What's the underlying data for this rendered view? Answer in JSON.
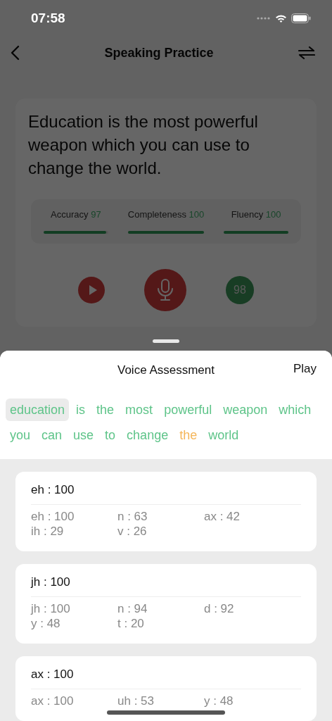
{
  "status_bar": {
    "time": "07:58"
  },
  "nav": {
    "title": "Speaking Practice"
  },
  "practice": {
    "sentence": "Education is the most powerful weapon which you can use to change the world.",
    "metrics": [
      {
        "label": "Accuracy",
        "value": "97",
        "level": 0.97
      },
      {
        "label": "Completeness",
        "value": "100",
        "level": 1
      },
      {
        "label": "Fluency",
        "value": "100",
        "level": 1
      }
    ],
    "score": "98"
  },
  "sheet": {
    "title": "Voice Assessment",
    "action": "Play",
    "words": [
      {
        "text": "education",
        "color": "#5ec489",
        "selected": true
      },
      {
        "text": "is",
        "color": "#5ec489",
        "selected": false
      },
      {
        "text": "the",
        "color": "#5ec489",
        "selected": false
      },
      {
        "text": "most",
        "color": "#5ec489",
        "selected": false
      },
      {
        "text": "powerful",
        "color": "#5ec489",
        "selected": false
      },
      {
        "text": "weapon",
        "color": "#5ec489",
        "selected": false
      },
      {
        "text": "which",
        "color": "#5ec489",
        "selected": false
      },
      {
        "text": "you",
        "color": "#5ec489",
        "selected": false
      },
      {
        "text": "can",
        "color": "#5ec489",
        "selected": false
      },
      {
        "text": "use",
        "color": "#5ec489",
        "selected": false
      },
      {
        "text": "to",
        "color": "#5ec489",
        "selected": false
      },
      {
        "text": "change",
        "color": "#5ec489",
        "selected": false
      },
      {
        "text": "the",
        "color": "#f5b65a",
        "selected": false
      },
      {
        "text": "world",
        "color": "#5ec489",
        "selected": false
      }
    ],
    "phonemes": [
      {
        "heading": "eh : 100",
        "details": [
          "eh : 100",
          "n : 63",
          "ax : 42",
          "ih : 29",
          "v : 26"
        ]
      },
      {
        "heading": "jh : 100",
        "details": [
          "jh : 100",
          "n : 94",
          "d : 92",
          "y : 48",
          "t : 20"
        ]
      },
      {
        "heading": "ax : 100",
        "details": [
          "ax : 100",
          "uh : 53",
          "y : 48"
        ]
      }
    ]
  }
}
